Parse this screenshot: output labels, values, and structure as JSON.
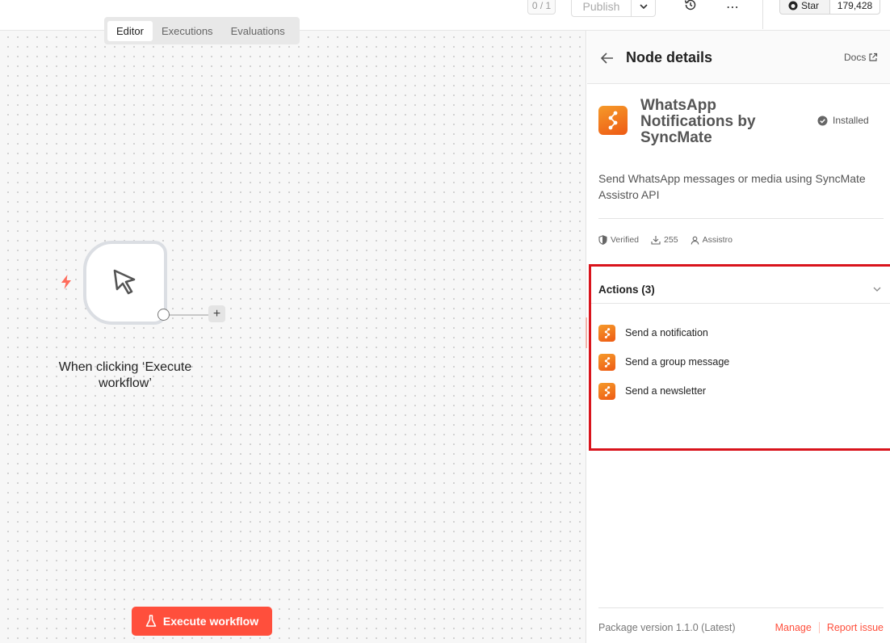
{
  "topbar": {
    "tabs": [
      "Editor",
      "Executions",
      "Evaluations"
    ],
    "active_tab": "Editor",
    "counter": "0 / 1",
    "publish_label": "Publish",
    "github_star_label": "Star",
    "github_star_count": "179,428"
  },
  "canvas": {
    "trigger_node_label": "When clicking ‘Execute workflow’",
    "execute_button_label": "Execute workflow"
  },
  "panel": {
    "title": "Node details",
    "docs_label": "Docs",
    "package_name": "WhatsApp Notifications by SyncMate",
    "installed_label": "Installed",
    "description": "Send WhatsApp messages or media using SyncMate Assistro API",
    "meta": {
      "verified_label": "Verified",
      "downloads": "255",
      "author": "Assistro"
    },
    "actions_title": "Actions (3)",
    "actions": [
      "Send a notification",
      "Send a group message",
      "Send a newsletter"
    ],
    "footer": {
      "version": "Package version 1.1.0 (Latest)",
      "manage_label": "Manage",
      "report_label": "Report issue"
    }
  },
  "colors": {
    "accent": "#ff4f3c",
    "highlight_border": "#d9141c",
    "package_icon": "#f07a1e"
  }
}
